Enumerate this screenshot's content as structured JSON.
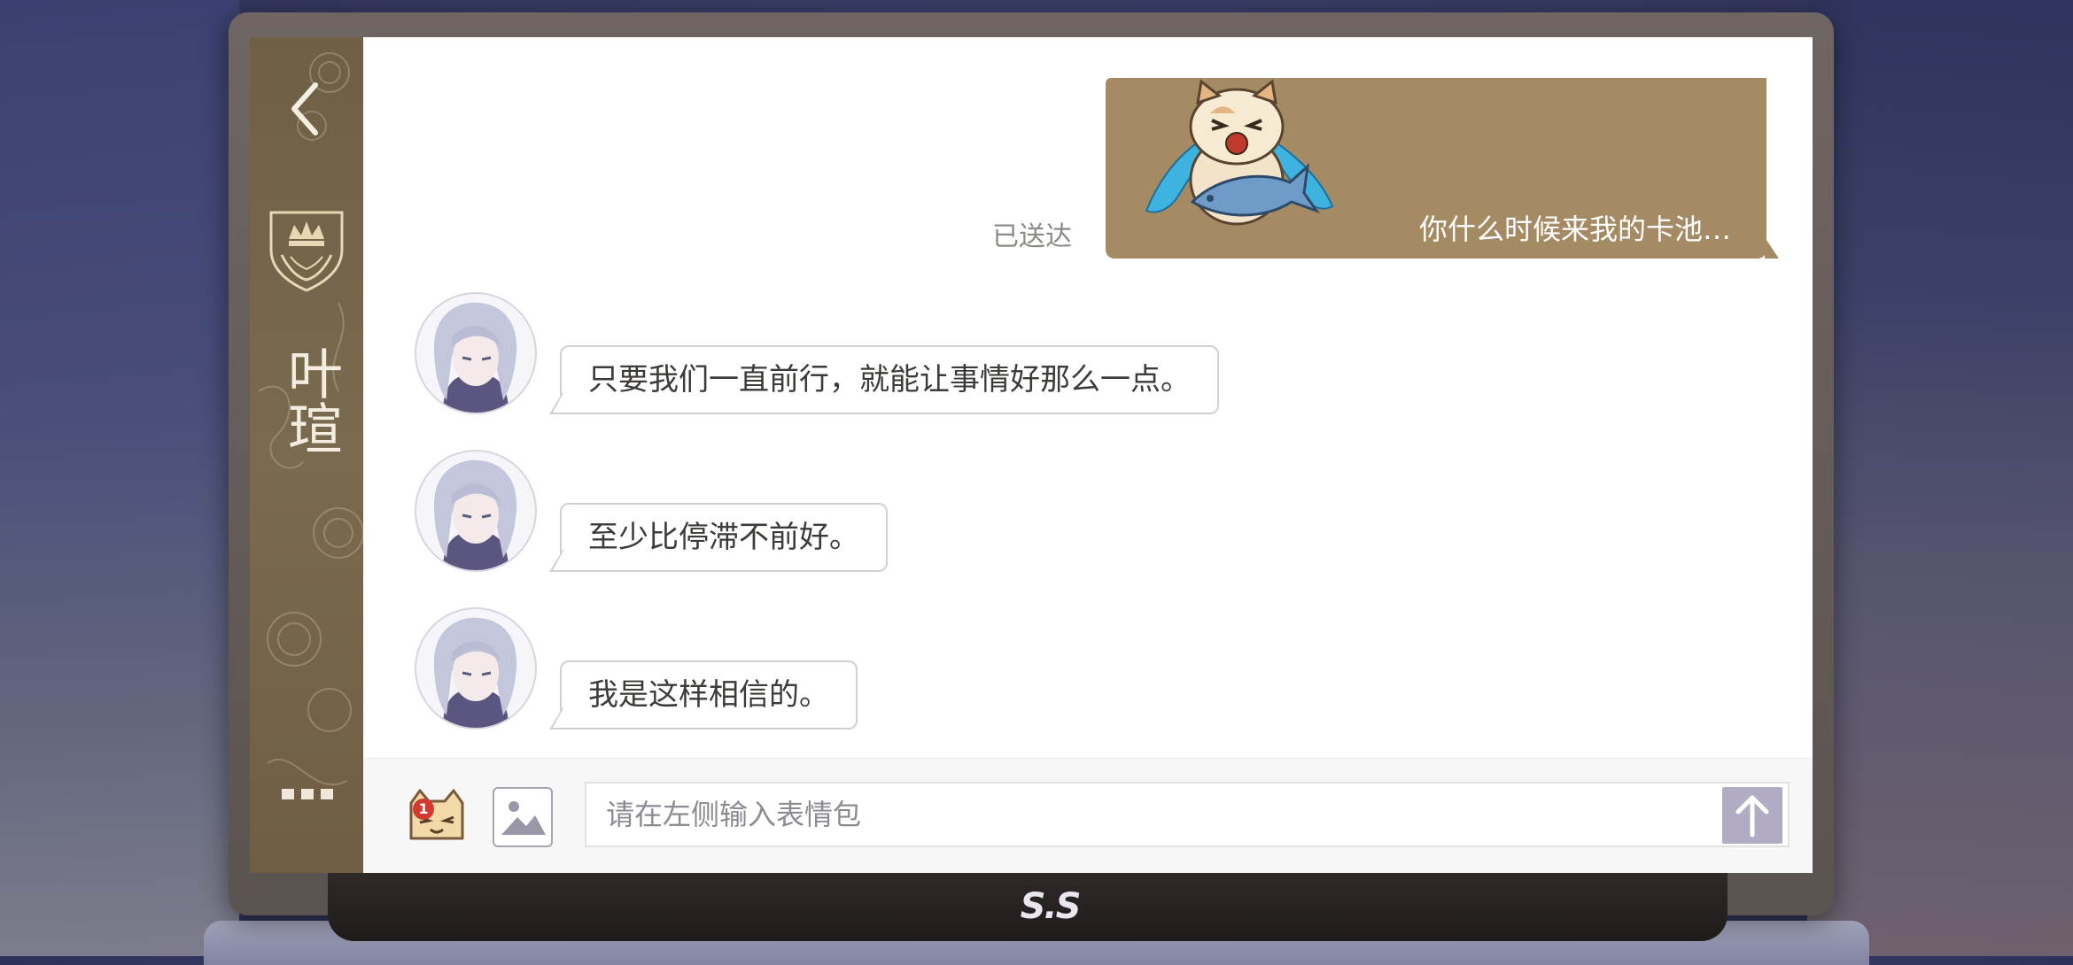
{
  "sidebar": {
    "back_icon": "chevron-left-icon",
    "crest_icon": "crown-crest-icon",
    "contact_name": "叶瑄",
    "more_icon": "more-dots-icon"
  },
  "chat": {
    "sent_message": {
      "status": "已送达",
      "sticker": "crying-cat-holding-fish-sticker",
      "text": "你什么时候来我的卡池…"
    },
    "received_messages": [
      {
        "text": "只要我们一直前行，就能让事情好那么一点。"
      },
      {
        "text": "至少比停滞不前好。"
      },
      {
        "text": "我是这样相信的。"
      }
    ]
  },
  "input_bar": {
    "emoji_icon": "cat-emoji-icon",
    "emoji_badge": "1",
    "image_icon": "image-icon",
    "placeholder": "请在左侧输入表情包",
    "send_icon": "arrow-up-icon"
  },
  "device": {
    "brand": "S.S"
  },
  "colors": {
    "sidebar": "#76654a",
    "sent_bubble": "#a58b63",
    "send_button": "#b1acc3",
    "badge": "#d23a2f"
  }
}
